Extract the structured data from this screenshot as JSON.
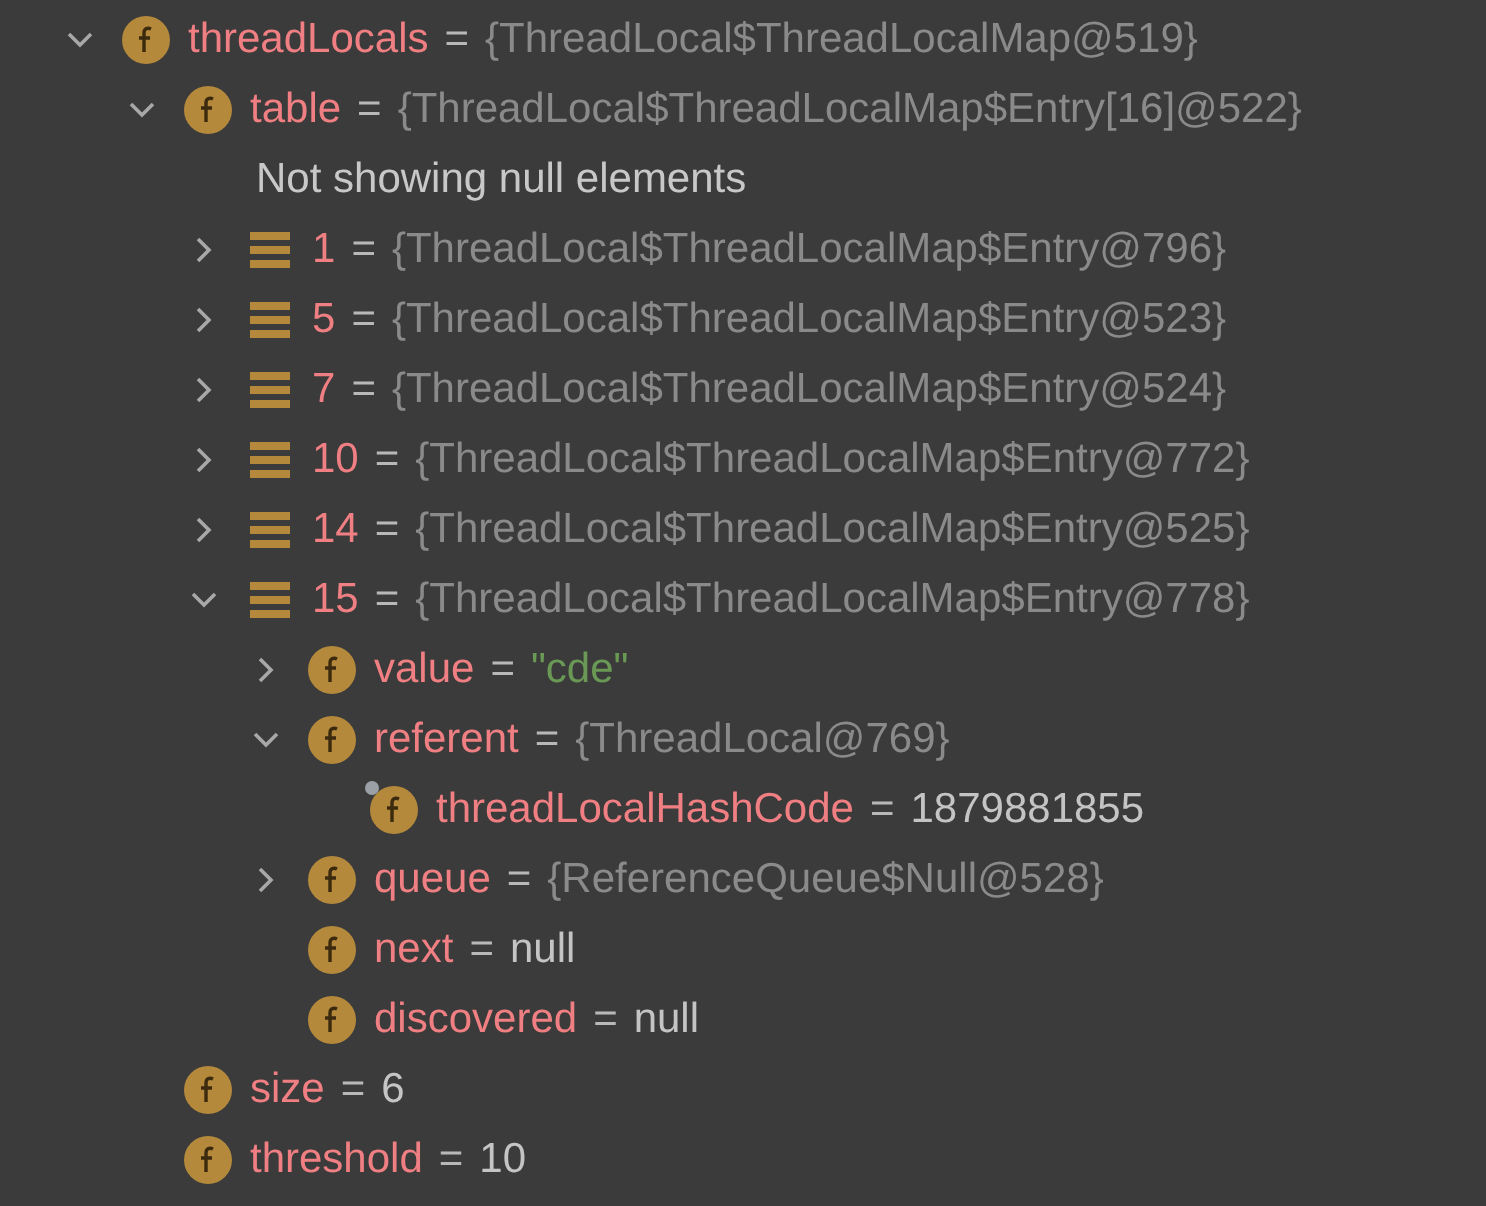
{
  "variables": [
    {
      "kind": "field",
      "name": "threadLocals",
      "operator": "=",
      "value": "{ThreadLocal$ThreadLocalMap@519}",
      "color": "#8a8a8a",
      "expanded": true,
      "children": [
        {
          "kind": "field",
          "name": "table",
          "operator": "=",
          "value": "{ThreadLocal$ThreadLocalMap$Entry[16]@522}",
          "color": "#8a8a8a",
          "expanded": true,
          "children": [
            {
              "kind": "message",
              "text": "Not showing null elements"
            },
            {
              "kind": "element",
              "name": "1",
              "operator": "=",
              "value": "{ThreadLocal$ThreadLocalMap$Entry@796}",
              "color": "#8a8a8a",
              "expanded": false
            },
            {
              "kind": "element",
              "name": "5",
              "operator": "=",
              "value": "{ThreadLocal$ThreadLocalMap$Entry@523}",
              "color": "#8a8a8a",
              "expanded": false
            },
            {
              "kind": "element",
              "name": "7",
              "operator": "=",
              "value": "{ThreadLocal$ThreadLocalMap$Entry@524}",
              "color": "#8a8a8a",
              "expanded": false
            },
            {
              "kind": "element",
              "name": "10",
              "operator": "=",
              "value": "{ThreadLocal$ThreadLocalMap$Entry@772}",
              "color": "#8a8a8a",
              "expanded": false
            },
            {
              "kind": "element",
              "name": "14",
              "operator": "=",
              "value": "{ThreadLocal$ThreadLocalMap$Entry@525}",
              "color": "#8a8a8a",
              "expanded": false
            },
            {
              "kind": "element",
              "name": "15",
              "operator": "=",
              "value": "{ThreadLocal$ThreadLocalMap$Entry@778}",
              "color": "#8a8a8a",
              "expanded": true,
              "children": [
                {
                  "kind": "field",
                  "name": "value",
                  "operator": "=",
                  "value": "\"cde\"",
                  "color": "#6a9955",
                  "expanded": false
                },
                {
                  "kind": "field",
                  "name": "referent",
                  "operator": "=",
                  "value": "{ThreadLocal@769}",
                  "color": "#8a8a8a",
                  "expanded": true,
                  "children": [
                    {
                      "kind": "field",
                      "name": "threadLocalHashCode",
                      "operator": "=",
                      "value": "1879881855",
                      "color": "#c4c4c4",
                      "final": true
                    }
                  ]
                },
                {
                  "kind": "field",
                  "name": "queue",
                  "operator": "=",
                  "value": "{ReferenceQueue$Null@528}",
                  "color": "#8a8a8a",
                  "expanded": false
                },
                {
                  "kind": "field",
                  "name": "next",
                  "operator": "=",
                  "value": "null",
                  "color": "#c4c4c4"
                },
                {
                  "kind": "field",
                  "name": "discovered",
                  "operator": "=",
                  "value": "null",
                  "color": "#c4c4c4"
                }
              ]
            }
          ]
        },
        {
          "kind": "field",
          "name": "size",
          "operator": "=",
          "value": "6",
          "color": "#c4c4c4"
        },
        {
          "kind": "field",
          "name": "threshold",
          "operator": "=",
          "value": "10",
          "color": "#c4c4c4"
        }
      ]
    }
  ]
}
